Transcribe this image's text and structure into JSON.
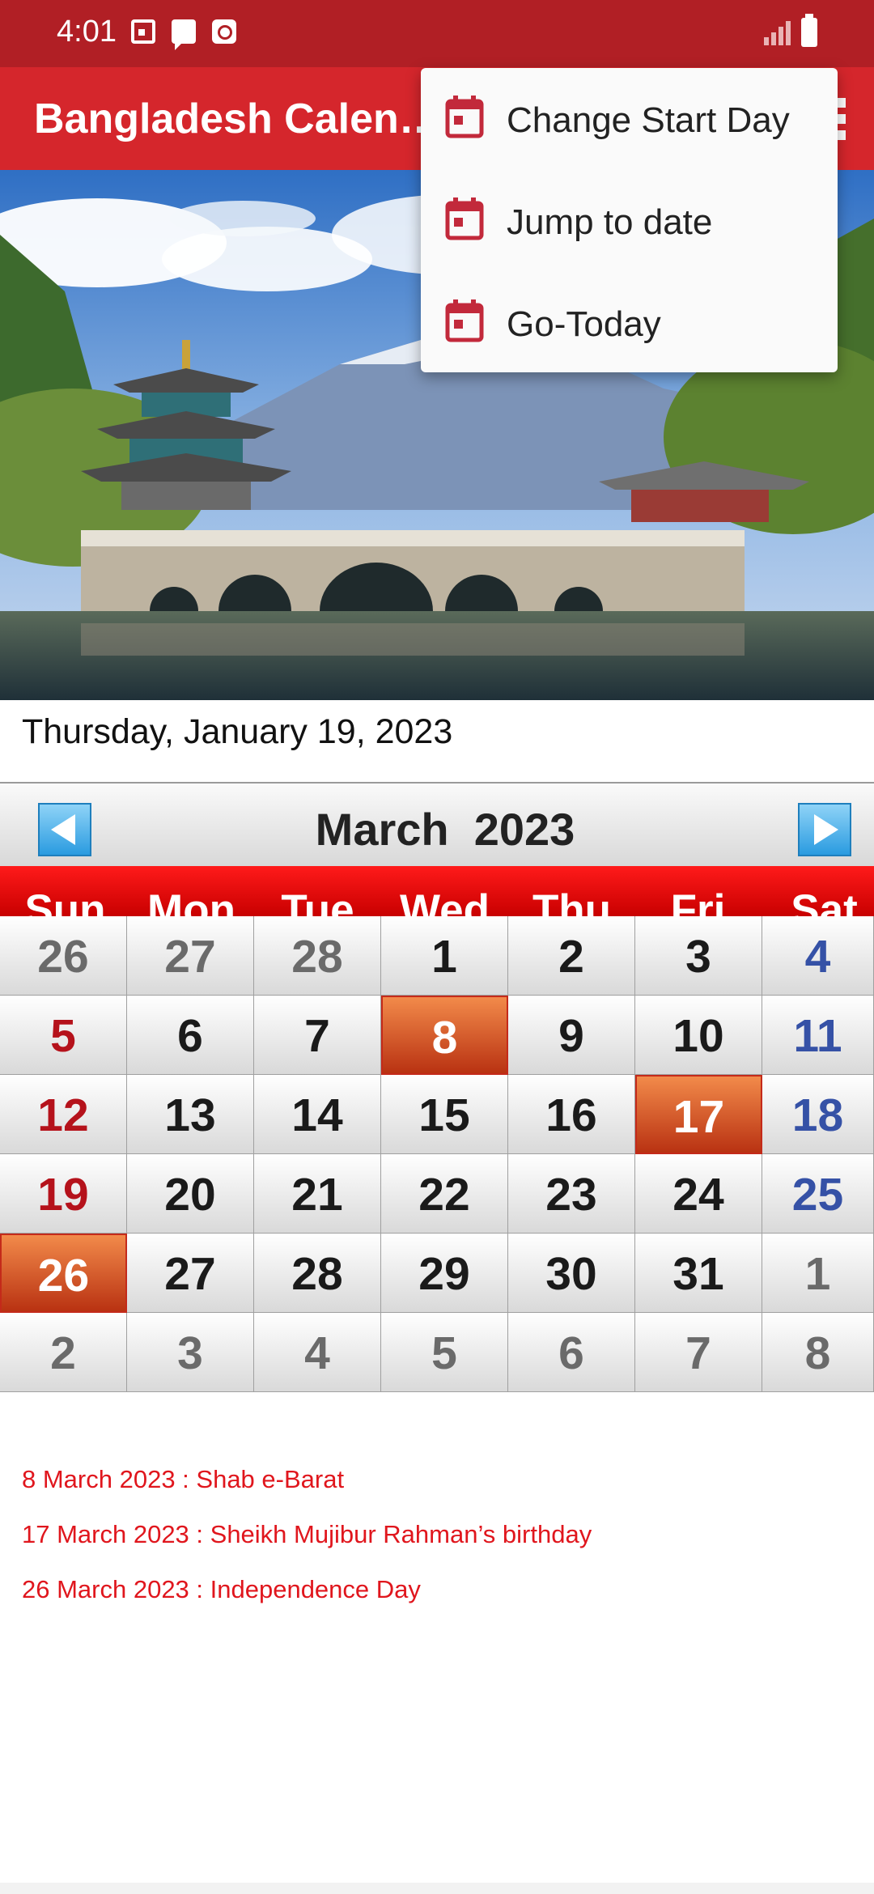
{
  "status_bar": {
    "time": "4:01",
    "icons": [
      "calendar-icon",
      "message-icon",
      "alarm-icon",
      "signal-icon",
      "battery-icon"
    ]
  },
  "app_bar": {
    "title": "Bangladesh Calen…",
    "overflow_icon": "more-vert-icon",
    "color": "#d5262c"
  },
  "menu": {
    "items": [
      {
        "label": "Change Start Day",
        "icon": "calendar-icon"
      },
      {
        "label": "Jump to date",
        "icon": "calendar-icon"
      },
      {
        "label": "Go-Today",
        "icon": "calendar-icon"
      }
    ]
  },
  "current_date": "Thursday, January 19, 2023",
  "calendar": {
    "month_title": "March  2023",
    "prev_icon": "arrow-left-icon",
    "next_icon": "arrow-right-icon",
    "weekdays": [
      "Sun",
      "Mon",
      "Tue",
      "Wed",
      "Thu",
      "Fri",
      "Sat"
    ],
    "weeks": [
      [
        "26",
        "27",
        "28",
        "1",
        "2",
        "3",
        "4"
      ],
      [
        "5",
        "6",
        "7",
        "8",
        "9",
        "10",
        "11"
      ],
      [
        "12",
        "13",
        "14",
        "15",
        "16",
        "17",
        "18"
      ],
      [
        "19",
        "20",
        "21",
        "22",
        "23",
        "24",
        "25"
      ],
      [
        "26",
        "27",
        "28",
        "29",
        "30",
        "31",
        "1"
      ],
      [
        "2",
        "3",
        "4",
        "5",
        "6",
        "7",
        "8"
      ]
    ],
    "holidays": [
      "8",
      "17",
      "26"
    ],
    "colors": {
      "weekday_header": "#e00000",
      "sunday": "#b5121b",
      "saturday": "#3551a6",
      "holiday": "#d9541f"
    }
  },
  "events": [
    "8 March 2023 : Shab e-Barat",
    "17 March 2023 : Sheikh Mujibur Rahman’s birthday",
    "26 March 2023 : Independence Day"
  ]
}
